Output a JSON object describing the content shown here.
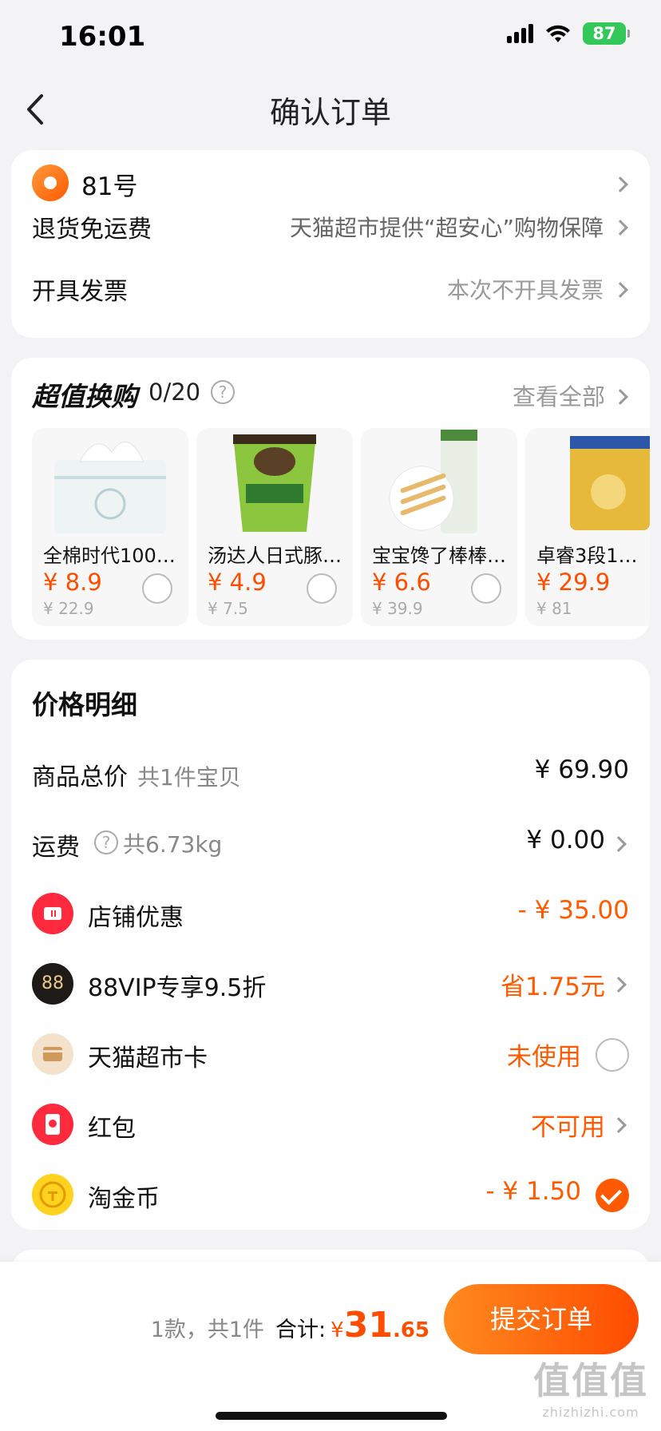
{
  "status_bar": {
    "time": "16:01",
    "battery": "87"
  },
  "nav": {
    "title": "确认订单"
  },
  "address": {
    "text": "81号"
  },
  "info_rows": [
    {
      "label": "退货免运费",
      "value": "天猫超市提供“超安心”购物保障"
    },
    {
      "label": "开具发票",
      "value": "本次不开具发票"
    }
  ],
  "swap": {
    "title": "超值换购",
    "count": "0/20",
    "more": "查看全部",
    "products": [
      {
        "name": "全棉时代100…",
        "price": "¥ 8.9",
        "original": "¥ 22.9"
      },
      {
        "name": "汤达人日式豚…",
        "price": "¥ 4.9",
        "original": "¥ 7.5"
      },
      {
        "name": "宝宝馋了棒棒…",
        "price": "¥ 6.6",
        "original": "¥ 39.9"
      },
      {
        "name": "卓睿3段1…",
        "price": "¥ 29.9",
        "original": "¥ 81"
      }
    ]
  },
  "price_detail": {
    "heading": "价格明细",
    "goods_total": {
      "label": "商品总价",
      "sub": "共1件宝贝",
      "value": "¥ 69.90"
    },
    "shipping": {
      "label": "运费",
      "sub": "共6.73kg",
      "value": "¥ 0.00"
    },
    "store_discount": {
      "label": "店铺优惠",
      "value": "- ¥ 35.00"
    },
    "vip": {
      "label": "88VIP专享9.5折",
      "value": "省1.75元",
      "icon_text": "88"
    },
    "market_card": {
      "label": "天猫超市卡",
      "value": "未使用"
    },
    "red_packet": {
      "label": "红包",
      "value": "不可用"
    },
    "gold_coin": {
      "label": "淘金币",
      "value": "- ¥ 1.50"
    }
  },
  "bottom": {
    "count": "1款，共1件",
    "total_label": "合计:",
    "currency": "¥",
    "total_int": "31",
    "total_dec": ".65",
    "submit": "提交订单"
  },
  "watermark": {
    "main": "值值值",
    "sub": "zhizhizhi.com"
  },
  "colors": {
    "accent": "#ff5a00",
    "price": "#ff4d00",
    "background": "#f3f3f5"
  }
}
